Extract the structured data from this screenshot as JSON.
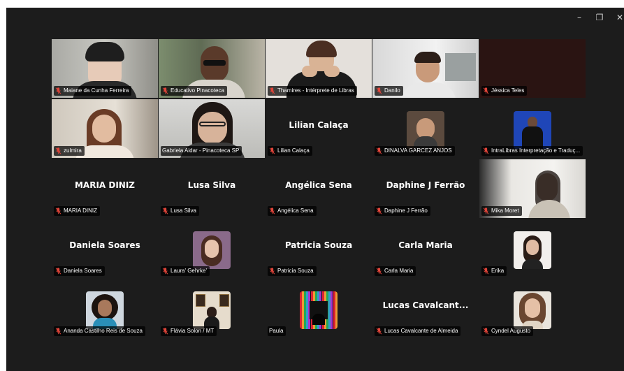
{
  "window": {
    "controls": {
      "minimize": "–",
      "restore": "❐",
      "close": "✕"
    },
    "accent_speaking": "#2fd06a",
    "muted_color": "#e0453a"
  },
  "participants": [
    {
      "label": "Maiane da Cunha Ferreira",
      "muted": true,
      "kind": "video"
    },
    {
      "label": "Educativo Pinacoteca",
      "muted": true,
      "kind": "video"
    },
    {
      "label": "Thamires - Intérprete de Libras",
      "muted": true,
      "kind": "video"
    },
    {
      "label": "Danilo",
      "muted": true,
      "kind": "video"
    },
    {
      "label": "Jéssica Teles",
      "muted": true,
      "kind": "video-dark"
    },
    {
      "label": "zulmira",
      "muted": true,
      "kind": "video"
    },
    {
      "label": "Gabriela Aidar - Pinacoteca SP",
      "muted": false,
      "kind": "video",
      "speaking": true
    },
    {
      "label": "Lilian Calaça",
      "display": "Lilian Calaça",
      "muted": true,
      "kind": "name"
    },
    {
      "label": "DINALVA GARCEZ ANJOS",
      "muted": true,
      "kind": "photo"
    },
    {
      "label": "IntraLibras Interpretação e Traduç...",
      "muted": true,
      "kind": "photo"
    },
    {
      "label": "MARIA DINIZ",
      "display": "MARIA DINIZ",
      "muted": true,
      "kind": "name"
    },
    {
      "label": "Lusa Silva",
      "display": "Lusa Silva",
      "muted": true,
      "kind": "name"
    },
    {
      "label": "Angélica Sena",
      "display": "Angélica Sena",
      "muted": true,
      "kind": "name"
    },
    {
      "label": "Daphine J Ferrão",
      "display": "Daphine J Ferrão",
      "muted": true,
      "kind": "name"
    },
    {
      "label": "Mika Moret",
      "muted": true,
      "kind": "video"
    },
    {
      "label": "Daniela Soares",
      "display": "Daniela Soares",
      "muted": true,
      "kind": "name"
    },
    {
      "label": "Laura' Gehrke'",
      "muted": true,
      "kind": "photo"
    },
    {
      "label": "Patricia Souza",
      "display": "Patricia Souza",
      "muted": true,
      "kind": "name"
    },
    {
      "label": "Carla Maria",
      "display": "Carla Maria",
      "muted": true,
      "kind": "name"
    },
    {
      "label": "Erika",
      "muted": true,
      "kind": "photo"
    },
    {
      "label": "Ananda Castilho Reis de Souza",
      "muted": true,
      "kind": "photo"
    },
    {
      "label": "Flávia Solon / MT",
      "muted": true,
      "kind": "photo"
    },
    {
      "label": "Paula",
      "muted": false,
      "kind": "photo"
    },
    {
      "label": "Lucas Cavalcante de Almeida",
      "display": "Lucas Cavalcant...",
      "muted": true,
      "kind": "name"
    },
    {
      "label": "Cyndel Augusto",
      "muted": true,
      "kind": "photo"
    }
  ]
}
